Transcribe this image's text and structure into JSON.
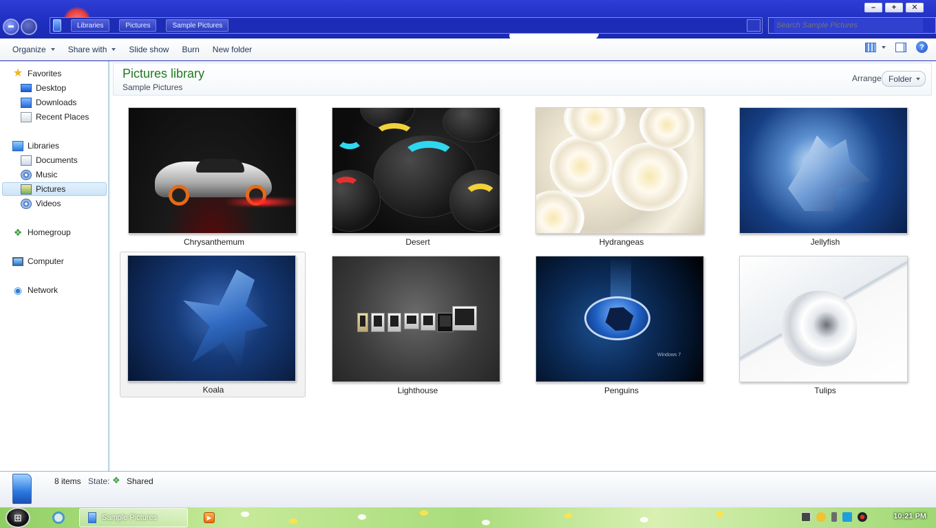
{
  "window": {
    "controls": {
      "minimize": "–",
      "maximize": "+",
      "close": "✕"
    },
    "breadcrumbs": [
      "Libraries",
      "Pictures",
      "Sample Pictures"
    ],
    "search_placeholder": "Search Sample Pictures"
  },
  "toolbar": {
    "organize": "Organize",
    "share_with": "Share with",
    "slide_show": "Slide show",
    "burn": "Burn",
    "new_folder": "New folder",
    "help": "?"
  },
  "navpane": {
    "favorites": {
      "label": "Favorites",
      "items": [
        "Desktop",
        "Downloads",
        "Recent Places"
      ]
    },
    "libraries": {
      "label": "Libraries",
      "items": [
        "Documents",
        "Music",
        "Pictures",
        "Videos"
      ],
      "selected": "Pictures"
    },
    "homegroup": "Homegroup",
    "computer": "Computer",
    "network": "Network"
  },
  "library": {
    "title": "Pictures library",
    "subtitle": "Sample Pictures",
    "arrange_label": "Arrange by:",
    "arrange_value": "Folder"
  },
  "files": [
    {
      "name": "Chrysanthemum"
    },
    {
      "name": "Desert"
    },
    {
      "name": "Hydrangeas"
    },
    {
      "name": "Jellyfish"
    },
    {
      "name": "Koala",
      "selected": true
    },
    {
      "name": "Lighthouse"
    },
    {
      "name": "Penguins",
      "thumb_text": "Windows 7"
    },
    {
      "name": "Tulips"
    }
  ],
  "status": {
    "count": "8 items",
    "state_label": "State:",
    "state_value": "Shared"
  },
  "taskbar": {
    "active_window": "Sample Pictures",
    "clock": "10:21 PM"
  },
  "colors": {
    "library_title": "#1e7b1e",
    "titlebar": "#2e3ed6",
    "selection": "#cde5f8"
  }
}
